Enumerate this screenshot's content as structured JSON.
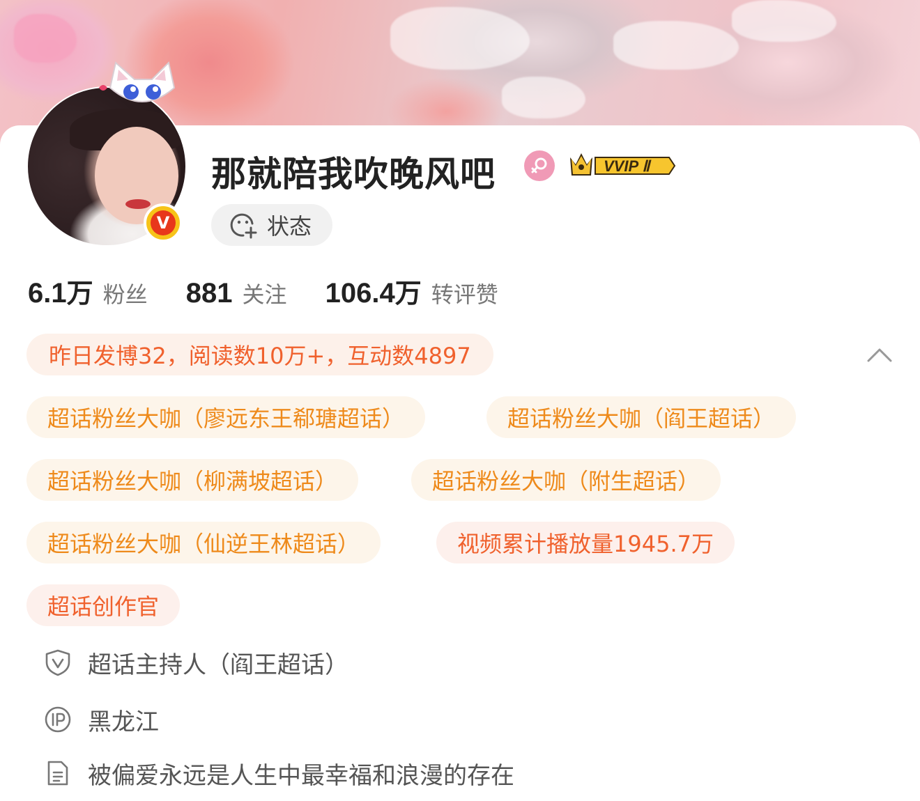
{
  "profile": {
    "name": "那就陪我吹晚风吧",
    "verified_mark": "V",
    "vip_badge": "VVIP Ⅱ",
    "status_label": "状态"
  },
  "stats": [
    {
      "num": "6.1",
      "unit": "万",
      "label": "粉丝"
    },
    {
      "num": "881",
      "unit": "",
      "label": "关注"
    },
    {
      "num": "106.4",
      "unit": "万",
      "label": "转评赞"
    }
  ],
  "summary": "昨日发博32，阅读数10万+，互动数4897",
  "tags": [
    "超话粉丝大咖（廖远东王郗瑭超话）",
    "超话粉丝大咖（阎王超话）",
    "超话粉丝大咖（柳满坡超话）",
    "超话粉丝大咖（附生超话）",
    "超话粉丝大咖（仙逆王林超话）",
    "视频累计播放量1945.7万",
    "超话创作官"
  ],
  "info": {
    "host": "超话主持人（阎王超话）",
    "location": "黑龙江",
    "bio": "被偏爱永远是人生中最幸福和浪漫的存在"
  },
  "colors": {
    "accent_orange": "#f0612d",
    "gold_text": "#ee8a1b",
    "verified_yellow": "#f7c319",
    "female_pink": "#f09ab6"
  },
  "icons": [
    "female-icon",
    "crown-icon",
    "smiley-plus-icon",
    "chevron-up-icon",
    "shield-v-icon",
    "ip-icon",
    "document-icon"
  ]
}
